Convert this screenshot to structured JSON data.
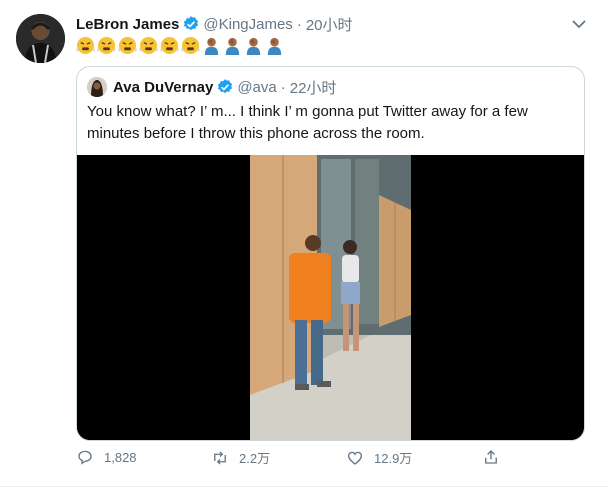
{
  "tweet": {
    "author_name": "LeBron James",
    "author_handle": "@KingJames",
    "separator": "·",
    "time": "20小时",
    "emoji_text": "😤😤😤😤😤😤🤦🏾‍♂️🤦🏾‍♂️🤦🏾‍♂️🤦🏾‍♂️",
    "emojis": [
      "face-with-steam-icon",
      "face-with-steam-icon",
      "face-with-steam-icon",
      "face-with-steam-icon",
      "face-with-steam-icon",
      "face-with-steam-icon",
      "facepalm-icon",
      "facepalm-icon",
      "facepalm-icon",
      "facepalm-icon"
    ]
  },
  "quoted": {
    "author_name": "Ava DuVernay",
    "author_handle": "@ava",
    "separator": "·",
    "time": "22小时",
    "text": "You know what? I’ m... I think I’ m gonna put Twitter away for a few minutes before I throw this phone across the room."
  },
  "actions": {
    "reply_count": "1,828",
    "retweet_count": "2.2万",
    "like_count": "12.9万"
  },
  "colors": {
    "verified": "#1da1f2",
    "secondary_text": "#657786",
    "border": "#ccd6dd",
    "emoji_yellow": "#f9c133",
    "skin_tone": "#a56c43",
    "shirt_orange": "#f07f1e",
    "plywood": "#d6a879"
  }
}
